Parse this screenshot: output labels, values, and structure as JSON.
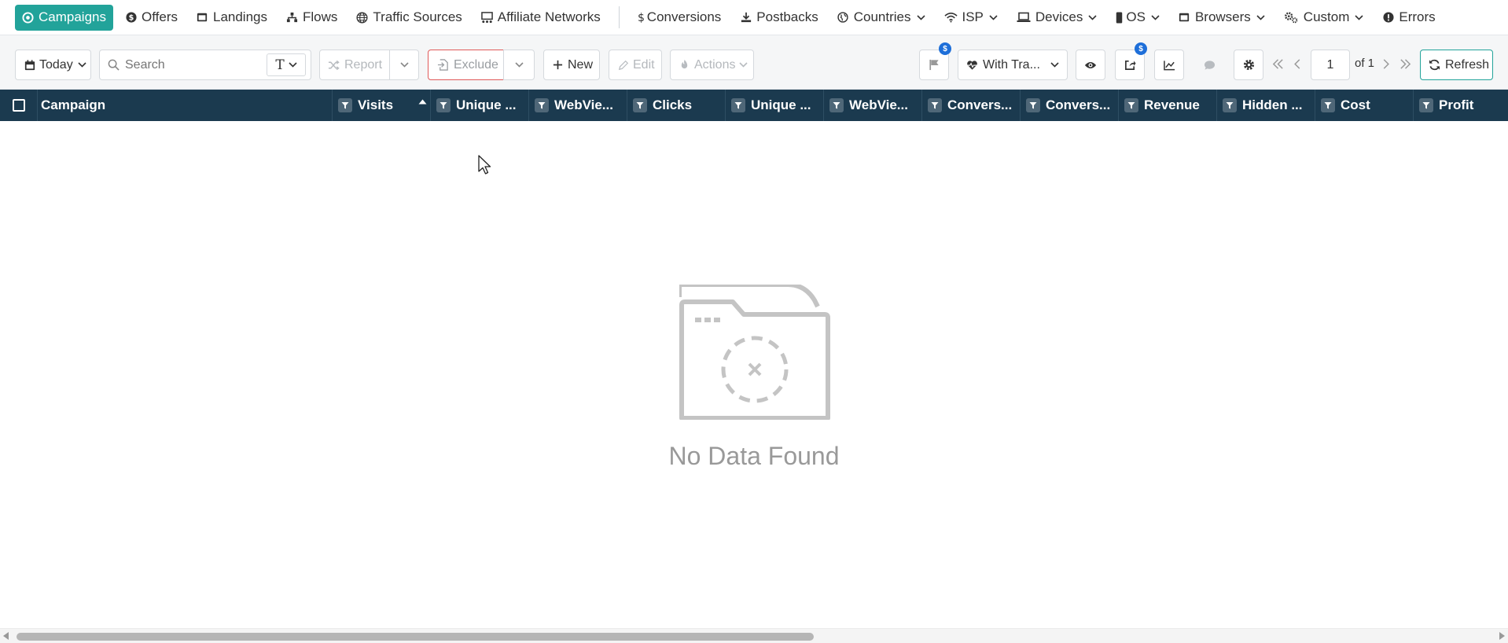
{
  "nav": {
    "items": [
      {
        "label": "Campaigns",
        "icon": "campaigns-icon"
      },
      {
        "label": "Offers",
        "icon": "dollar-circle-icon"
      },
      {
        "label": "Landings",
        "icon": "landing-icon"
      },
      {
        "label": "Flows",
        "icon": "flows-icon"
      },
      {
        "label": "Traffic Sources",
        "icon": "globe-icon"
      },
      {
        "label": "Affiliate Networks",
        "icon": "network-icon"
      },
      {
        "label": "Conversions",
        "icon": "dollar-icon"
      },
      {
        "label": "Postbacks",
        "icon": "download-icon"
      },
      {
        "label": "Countries",
        "icon": "globe-alt-icon"
      },
      {
        "label": "ISP",
        "icon": "wifi-icon"
      },
      {
        "label": "Devices",
        "icon": "laptop-icon"
      },
      {
        "label": "OS",
        "icon": "mobile-icon"
      },
      {
        "label": "Browsers",
        "icon": "browser-icon"
      },
      {
        "label": "Custom",
        "icon": "gears-icon"
      },
      {
        "label": "Errors",
        "icon": "exclamation-circle-icon"
      }
    ]
  },
  "toolbar": {
    "date_label": "Today",
    "search_placeholder": "Search",
    "search_type": "T",
    "report_label": "Report",
    "exclude_label": "Exclude",
    "new_label": "New",
    "edit_label": "Edit",
    "actions_label": "Actions",
    "flag_badge": "$",
    "traffic_filter_label": "With Tra...",
    "export_badge": "$",
    "page_value": "1",
    "page_total": "of 1",
    "refresh_label": "Refresh"
  },
  "table": {
    "columns": [
      {
        "label": "Campaign"
      },
      {
        "label": "Visits"
      },
      {
        "label": "Unique ..."
      },
      {
        "label": "WebVie..."
      },
      {
        "label": "Clicks"
      },
      {
        "label": "Unique ..."
      },
      {
        "label": "WebVie..."
      },
      {
        "label": "Convers..."
      },
      {
        "label": "Convers..."
      },
      {
        "label": "Revenue"
      },
      {
        "label": "Hidden ..."
      },
      {
        "label": "Cost"
      },
      {
        "label": "Profit"
      }
    ]
  },
  "empty_state": {
    "message": "No Data Found"
  },
  "colors": {
    "accent": "#22a39a",
    "header_bg": "#1b3a4f",
    "exclude_border": "#e05a5a",
    "badge": "#1e6fd9"
  }
}
